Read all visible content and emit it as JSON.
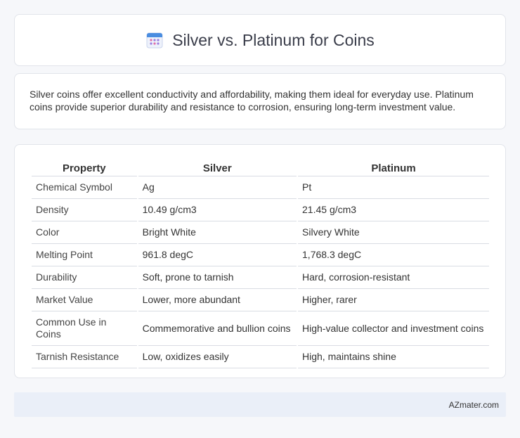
{
  "header": {
    "icon": "calendar-icon",
    "title": "Silver vs. Platinum for Coins"
  },
  "intro": {
    "text": "Silver coins offer excellent conductivity and affordability, making them ideal for everyday use. Platinum coins provide superior durability and resistance to corrosion, ensuring long-term investment value."
  },
  "table": {
    "headers": [
      "Property",
      "Silver",
      "Platinum"
    ],
    "rows": [
      [
        "Chemical Symbol",
        "Ag",
        "Pt"
      ],
      [
        "Density",
        "10.49 g/cm3",
        "21.45 g/cm3"
      ],
      [
        "Color",
        "Bright White",
        "Silvery White"
      ],
      [
        "Melting Point",
        "961.8 degC",
        "1,768.3 degC"
      ],
      [
        "Durability",
        "Soft, prone to tarnish",
        "Hard, corrosion-resistant"
      ],
      [
        "Market Value",
        "Lower, more abundant",
        "Higher, rarer"
      ],
      [
        "Common Use in Coins",
        "Commemorative and bullion coins",
        "High-value collector and investment coins"
      ],
      [
        "Tarnish Resistance",
        "Low, oxidizes easily",
        "High, maintains shine"
      ]
    ]
  },
  "footer": {
    "credit": "AZmater.com"
  },
  "colors": {
    "background": "#f6f7fa",
    "footer_bg": "#eaeff8",
    "icon_accent": "#4a8de0"
  }
}
